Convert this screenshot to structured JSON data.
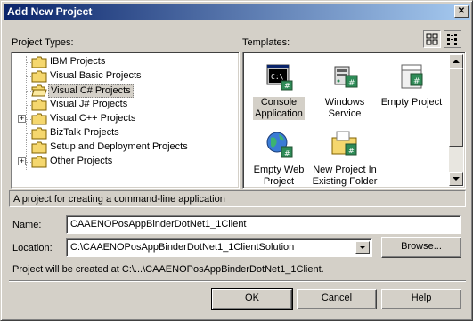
{
  "window": {
    "title": "Add New Project",
    "close_glyph": "✕"
  },
  "project_types": {
    "label": "Project Types:",
    "items": [
      {
        "label": "IBM Projects",
        "expandable": false
      },
      {
        "label": "Visual Basic Projects",
        "expandable": false
      },
      {
        "label": "Visual C# Projects",
        "expandable": false,
        "selected": true
      },
      {
        "label": "Visual J# Projects",
        "expandable": false
      },
      {
        "label": "Visual C++ Projects",
        "expandable": true
      },
      {
        "label": "BizTalk Projects",
        "expandable": false
      },
      {
        "label": "Setup and Deployment Projects",
        "expandable": false
      },
      {
        "label": "Other Projects",
        "expandable": true
      }
    ]
  },
  "templates": {
    "label": "Templates:",
    "items": [
      {
        "label_line1": "Console",
        "label_line2": "Application",
        "icon": "console-app-icon",
        "selected": true
      },
      {
        "label_line1": "Windows",
        "label_line2": "Service",
        "icon": "windows-service-icon"
      },
      {
        "label_line1": "Empty Project",
        "label_line2": "",
        "icon": "empty-project-icon"
      },
      {
        "label_line1": "Empty Web",
        "label_line2": "Project",
        "icon": "empty-web-project-icon"
      },
      {
        "label_line1": "New Project In",
        "label_line2": "Existing Folder",
        "icon": "folder-project-icon"
      }
    ]
  },
  "description": "A project for creating a command-line application",
  "name": {
    "label": "Name:",
    "value": "CAAENOPosAppBinderDotNet1_1Client"
  },
  "location": {
    "label": "Location:",
    "value": "C:\\CAAENOPosAppBinderDotNet1_1ClientSolution"
  },
  "browse_label": "Browse...",
  "created_at": "Project will be created at C:\\...\\CAAENOPosAppBinderDotNet1_1Client.",
  "buttons": {
    "ok": "OK",
    "cancel": "Cancel",
    "help": "Help"
  },
  "colors": {
    "title_start": "#0a246a",
    "title_end": "#a6caf0",
    "face": "#d4d0c8"
  }
}
